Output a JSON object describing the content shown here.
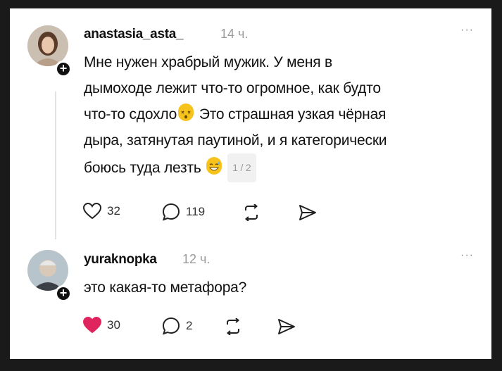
{
  "posts": [
    {
      "username": "anastasia_asta_",
      "time": "14 ч.",
      "more": "···",
      "lines": [
        "Мне нужен храбрый мужик. У меня в",
        "дымоходе лежит что-то огромное, как будто",
        "что-то сдохло",
        "Это страшная узкая чёрная",
        "дыра, затянутая паутиной, и я категорически",
        "боюсь туда лезть"
      ],
      "page_indicator": "1 / 2",
      "likes": "32",
      "replies": "119"
    },
    {
      "username": "yuraknopka",
      "time": "12 ч.",
      "more": "···",
      "text": "это какая-то метафора?",
      "likes": "30",
      "replies": "2",
      "liked_color": "#e0245e"
    }
  ]
}
